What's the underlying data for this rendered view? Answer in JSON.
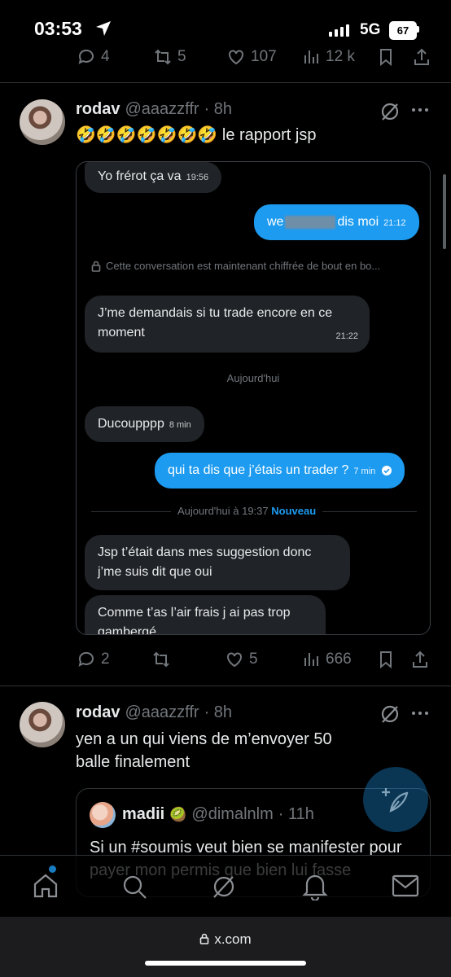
{
  "status_bar": {
    "time": "03:53",
    "network": "5G",
    "battery": "67"
  },
  "prev_tweet_actions": {
    "replies": "4",
    "retweets": "5",
    "likes": "107",
    "views": "12 k"
  },
  "tweet1": {
    "name": "rodav",
    "handle": "@aaazzffr",
    "time": "· 8h",
    "text": "🤣🤣🤣🤣🤣🤣🤣 le rapport jsp",
    "dm": {
      "m1": {
        "text": "Yo frérot ça va",
        "time": "19:56"
      },
      "m2_a": "we",
      "m2_b": "dis moi",
      "m2_time": "21:12",
      "encrypted": "Cette conversation est maintenant chiffrée de bout en bo...",
      "m3": {
        "text": "J’me demandais si tu trade encore en ce moment",
        "time": "21:22"
      },
      "today": "Aujourd'hui",
      "m4": {
        "text": "Ducoupppp",
        "time": "8 min"
      },
      "m5": {
        "text": "qui ta dis que j’étais un trader ?",
        "time": "7 min"
      },
      "new_divider": "Aujourd'hui à 19:37",
      "new_label": "Nouveau",
      "m6": {
        "text": "Jsp t’était dans mes suggestion donc j’me suis dit que oui"
      },
      "m7": {
        "text": "Comme t’as l’air frais j ai pas trop gambergé"
      }
    },
    "actions": {
      "replies": "2",
      "likes": "5",
      "views": "666"
    }
  },
  "tweet2": {
    "name": "rodav",
    "handle": "@aaazzffr",
    "time": "· 8h",
    "text": "yen a un qui viens de m’envoyer 50 balle finalement",
    "quote": {
      "name": "madii",
      "badge": "🥝",
      "handle": "@dimalnlm",
      "time": "· 11h",
      "text": "Si un #soumis veut bien se manifester pour payer mon permis que bien lui fasse"
    }
  },
  "browser": {
    "url": "x.com"
  },
  "colors": {
    "accent": "#1d9bf0",
    "bubble_other": "#202327",
    "secondary_text": "#71767b"
  }
}
